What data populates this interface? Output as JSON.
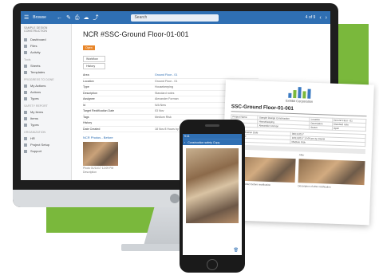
{
  "app": {
    "title": "Browse",
    "search_placeholder": "Search",
    "nav_counter": "4 of 9"
  },
  "sidebar": {
    "company": "SAMPLE DESIGN CONSTRUCTION",
    "items_top": [
      {
        "label": "Dashboard",
        "icon": "dashboard-icon"
      },
      {
        "label": "Files",
        "icon": "files-icon"
      },
      {
        "label": "Activity",
        "icon": "activity-icon"
      }
    ],
    "section_tools": "Tools",
    "items_tools": [
      {
        "label": "Sheets",
        "icon": "sheets-icon"
      },
      {
        "label": "Templates",
        "icon": "templates-icon"
      }
    ],
    "section_progress": "PROGRESS TO DONE",
    "items_progress": [
      {
        "label": "My Actions",
        "icon": "actions-icon"
      },
      {
        "label": "Actions",
        "icon": "actions-icon"
      },
      {
        "label": "Types",
        "icon": "types-icon"
      }
    ],
    "section_safety": "SAFETY REPORT",
    "items_safety": [
      {
        "label": "My Items",
        "icon": "items-icon"
      },
      {
        "label": "Items",
        "icon": "items-icon"
      },
      {
        "label": "Types",
        "icon": "types-icon"
      }
    ],
    "section_org": "ORGANIZATION",
    "items_org": [
      {
        "label": "HR",
        "icon": "hr-icon"
      },
      {
        "label": "Project Setup",
        "icon": "setup-icon"
      }
    ],
    "support": "Support"
  },
  "record": {
    "title": "NCR #SSC-Ground Floor-01-001",
    "tag": "Open",
    "actions": [
      "Workflow",
      "History"
    ],
    "fields": [
      {
        "key": "Area",
        "value": "Ground Floor - 01",
        "link": true
      },
      {
        "key": "Location",
        "value": "Ground Floor - 01",
        "link": false
      },
      {
        "key": "Type",
        "value": "Housekeeping",
        "link": false
      },
      {
        "key": "Description",
        "value": "Standard notes",
        "link": false
      },
      {
        "key": "Assignee",
        "value": "Alexander Forman",
        "link": false
      },
      {
        "key": "Id",
        "value": "N/A New",
        "link": false
      },
      {
        "key": "Target Rectification Date",
        "value": "03 Nov",
        "link": false
      },
      {
        "key": "Tags",
        "value": "Medium Risk",
        "link": false
      },
      {
        "key": "History",
        "value": "",
        "link": false
      },
      {
        "key": "Date Created",
        "value": "18 Nov 8 Hours by Daniel",
        "link": false
      }
    ],
    "photos_heading": "NCR Photos - Before",
    "photo_caption": "Photo 01/11/17 12:09 PM",
    "description_label": "Description"
  },
  "report": {
    "company": "Exhibit Corporation",
    "title": "SSC-Ground Floor-01-001",
    "rows": [
      [
        "Project Name",
        "Sample Design Construction",
        "Location",
        "Ground Floor - 01"
      ],
      [
        "Type",
        "Housekeeping",
        "Description",
        "Standard note"
      ],
      [
        "Assignee",
        "Alexander Forman",
        "Status",
        "Open"
      ]
    ],
    "rows2": [
      [
        "Target Rectification Date",
        "03/11/2017"
      ],
      [
        "Date Created",
        "18/11/2017 12:09 pm by Daniel"
      ],
      [
        "Tags",
        "Medium Risk"
      ]
    ],
    "section_label": "Photos",
    "photo_labels": [
      "Before",
      "After"
    ],
    "caption_before": "Description of defect before rectification",
    "caption_after": "Description of after rectification"
  },
  "mobile": {
    "status": "9:41",
    "title": "Construction safety Copy",
    "back": "‹"
  }
}
